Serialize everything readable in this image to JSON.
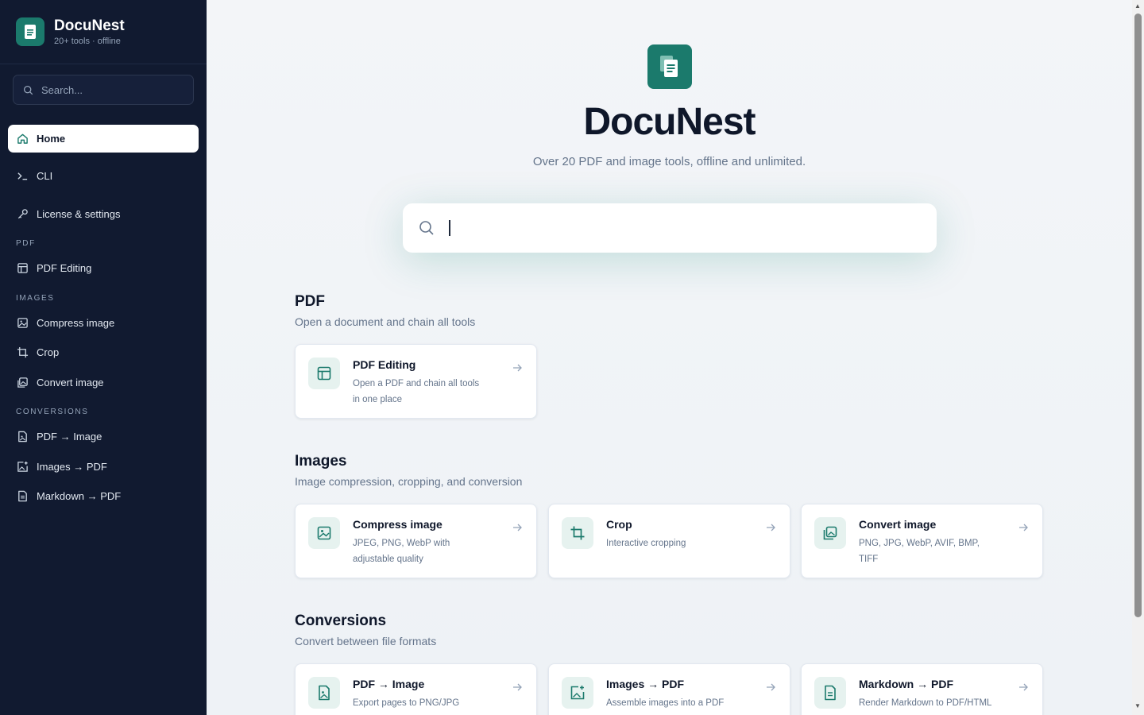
{
  "app": {
    "name": "DocuNest",
    "tagline": "20+ tools · offline",
    "accent": "#1b7a6c",
    "sidebar_bg": "#111a30"
  },
  "sidebar": {
    "search_placeholder": "Search...",
    "items": [
      {
        "label": "Home",
        "icon": "home-icon",
        "active": true
      },
      {
        "label": "CLI",
        "icon": "terminal-icon"
      },
      {
        "label": "License & settings",
        "icon": "key-icon"
      }
    ],
    "sections": [
      {
        "label": "PDF",
        "items": [
          {
            "label": "PDF Editing",
            "icon": "layout-icon"
          }
        ]
      },
      {
        "label": "IMAGES",
        "items": [
          {
            "label": "Compress image",
            "icon": "image-compress-icon"
          },
          {
            "label": "Crop",
            "icon": "crop-icon"
          },
          {
            "label": "Convert image",
            "icon": "image-convert-icon"
          }
        ]
      },
      {
        "label": "CONVERSIONS",
        "items": [
          {
            "label": "PDF → Image",
            "icon": "file-image-icon"
          },
          {
            "label": "Images → PDF",
            "icon": "image-plus-icon"
          },
          {
            "label": "Markdown → PDF",
            "icon": "file-text-icon"
          }
        ]
      }
    ]
  },
  "hero": {
    "title": "DocuNest",
    "subtitle": "Over 20 PDF and image tools, offline and unlimited.",
    "search_value": ""
  },
  "sections": [
    {
      "title": "PDF",
      "desc": "Open a document and chain all tools",
      "cards": [
        {
          "title": "PDF Editing",
          "desc": "Open a PDF and chain all tools in one place",
          "icon": "layout-icon"
        }
      ]
    },
    {
      "title": "Images",
      "desc": "Image compression, cropping, and conversion",
      "cards": [
        {
          "title": "Compress image",
          "desc": "JPEG, PNG, WebP with adjustable quality",
          "icon": "image-compress-icon"
        },
        {
          "title": "Crop",
          "desc": "Interactive cropping",
          "icon": "crop-icon"
        },
        {
          "title": "Convert image",
          "desc": "PNG, JPG, WebP, AVIF, BMP, TIFF",
          "icon": "image-convert-icon"
        }
      ]
    },
    {
      "title": "Conversions",
      "desc": "Convert between file formats",
      "cards": [
        {
          "title": "PDF → Image",
          "desc": "Export pages to PNG/JPG",
          "icon": "file-image-icon"
        },
        {
          "title": "Images → PDF",
          "desc": "Assemble images into a PDF",
          "icon": "image-plus-icon"
        },
        {
          "title": "Markdown → PDF",
          "desc": "Render Markdown to PDF/HTML",
          "icon": "file-text-icon"
        }
      ]
    }
  ]
}
